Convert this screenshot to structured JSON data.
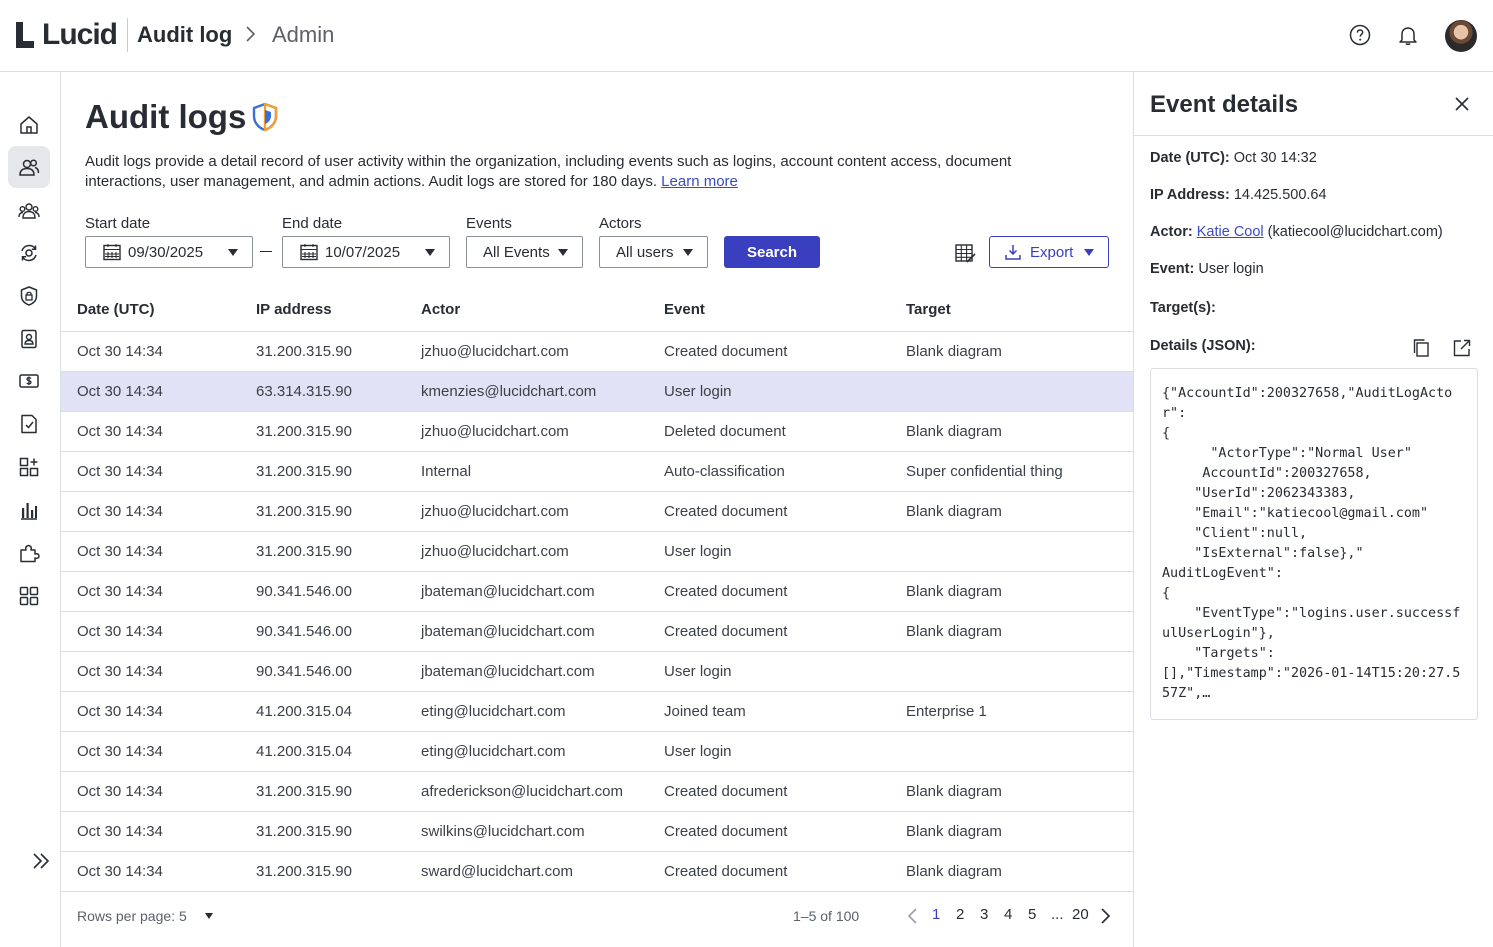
{
  "app": {
    "logo_text": "Lucid",
    "title": "Audit log",
    "breadcrumb": "Admin"
  },
  "page": {
    "title": "Audit logs",
    "description": "Audit logs provide a detail record of user activity within the organization, including events such as logins, account content access, document interactions, user management, and admin actions. Audit logs are stored for 180 days.",
    "learn_more": "Learn more"
  },
  "filters": {
    "start_label": "Start date",
    "start_value": "09/30/2025",
    "end_label": "End date",
    "end_value": "10/07/2025",
    "events_label": "Events",
    "events_value": "All Events",
    "actors_label": "Actors",
    "actors_value": "All users",
    "search_label": "Search",
    "export_label": "Export"
  },
  "table": {
    "headers": [
      "Date (UTC)",
      "IP address",
      "Actor",
      "Event",
      "Target"
    ],
    "rows": [
      [
        "Oct 30 14:34",
        "31.200.315.90",
        "jzhuo@lucidchart.com",
        "Created document",
        "Blank diagram"
      ],
      [
        "Oct 30 14:34",
        "63.314.315.90",
        "kmenzies@lucidchart.com",
        "User login",
        ""
      ],
      [
        "Oct 30 14:34",
        "31.200.315.90",
        "jzhuo@lucidchart.com",
        "Deleted document",
        "Blank diagram"
      ],
      [
        "Oct 30 14:34",
        "31.200.315.90",
        "Internal",
        "Auto-classification",
        "Super confidential thing"
      ],
      [
        "Oct 30 14:34",
        "31.200.315.90",
        "jzhuo@lucidchart.com",
        "Created document",
        "Blank diagram"
      ],
      [
        "Oct 30 14:34",
        "31.200.315.90",
        "jzhuo@lucidchart.com",
        "User login",
        ""
      ],
      [
        "Oct 30 14:34",
        "90.341.546.00",
        "jbateman@lucidchart.com",
        "Created document",
        "Blank diagram"
      ],
      [
        "Oct 30 14:34",
        "90.341.546.00",
        "jbateman@lucidchart.com",
        "Created document",
        "Blank diagram"
      ],
      [
        "Oct 30 14:34",
        "90.341.546.00",
        "jbateman@lucidchart.com",
        "User login",
        ""
      ],
      [
        "Oct 30 14:34",
        "41.200.315.04",
        "eting@lucidchart.com",
        "Joined team",
        "Enterprise 1"
      ],
      [
        "Oct 30 14:34",
        "41.200.315.04",
        "eting@lucidchart.com",
        "User login",
        ""
      ],
      [
        "Oct 30 14:34",
        "31.200.315.90",
        "afrederickson@lucidchart.com",
        "Created document",
        "Blank diagram"
      ],
      [
        "Oct 30 14:34",
        "31.200.315.90",
        "swilkins@lucidchart.com",
        "Created document",
        "Blank diagram"
      ],
      [
        "Oct 30 14:34",
        "31.200.315.90",
        "sward@lucidchart.com",
        "Created document",
        "Blank diagram"
      ]
    ],
    "selected_row": 1
  },
  "pagination": {
    "rows_per_page": "Rows per page: 5",
    "range": "1–5 of 100",
    "pages": [
      "1",
      "2",
      "3",
      "4",
      "5",
      "...",
      "20"
    ],
    "current": "1"
  },
  "panel": {
    "title": "Event details",
    "date_label": "Date (UTC):",
    "date_value": "Oct 30 14:32",
    "ip_label": "IP Address:",
    "ip_value": "14.425.500.64",
    "actor_label": "Actor:",
    "actor_name": "Katie Cool",
    "actor_email": "(katiecool@lucidchart.com)",
    "event_label": "Event:",
    "event_value": "User login",
    "targets_label": "Target(s):",
    "json_label": "Details (JSON):",
    "json_text": "{\"AccountId\":200327658,\"AuditLogActor\":\n{\n      \"ActorType\":\"Normal User\"\n     AccountId\":200327658,\n    \"UserId\":2062343383,\n    \"Email\":\"katiecool@gmail.com\"\n    \"Client\":null,\n    \"IsExternal\":false},\"\nAuditLogEvent\":\n{\n    \"EventType\":\"logins.user.successfulUserLogin\"},\n    \"Targets\":\n[],\"Timestamp\":\"2026-01-14T15:20:27.557Z\",…"
  },
  "colors": {
    "accent": "#3a3fc0",
    "selected_row": "#e1e2f5",
    "border": "#dadde2",
    "text": "#282c33"
  },
  "icons": {
    "rail": [
      "home-icon",
      "users-icon",
      "groups-icon",
      "settings-sync-icon",
      "lock-icon",
      "contact-card-icon",
      "billing-icon",
      "document-check-icon",
      "apps-add-icon",
      "chart-icon",
      "puzzle-icon",
      "grid-icon"
    ],
    "top": [
      "help-icon",
      "bell-icon"
    ]
  }
}
